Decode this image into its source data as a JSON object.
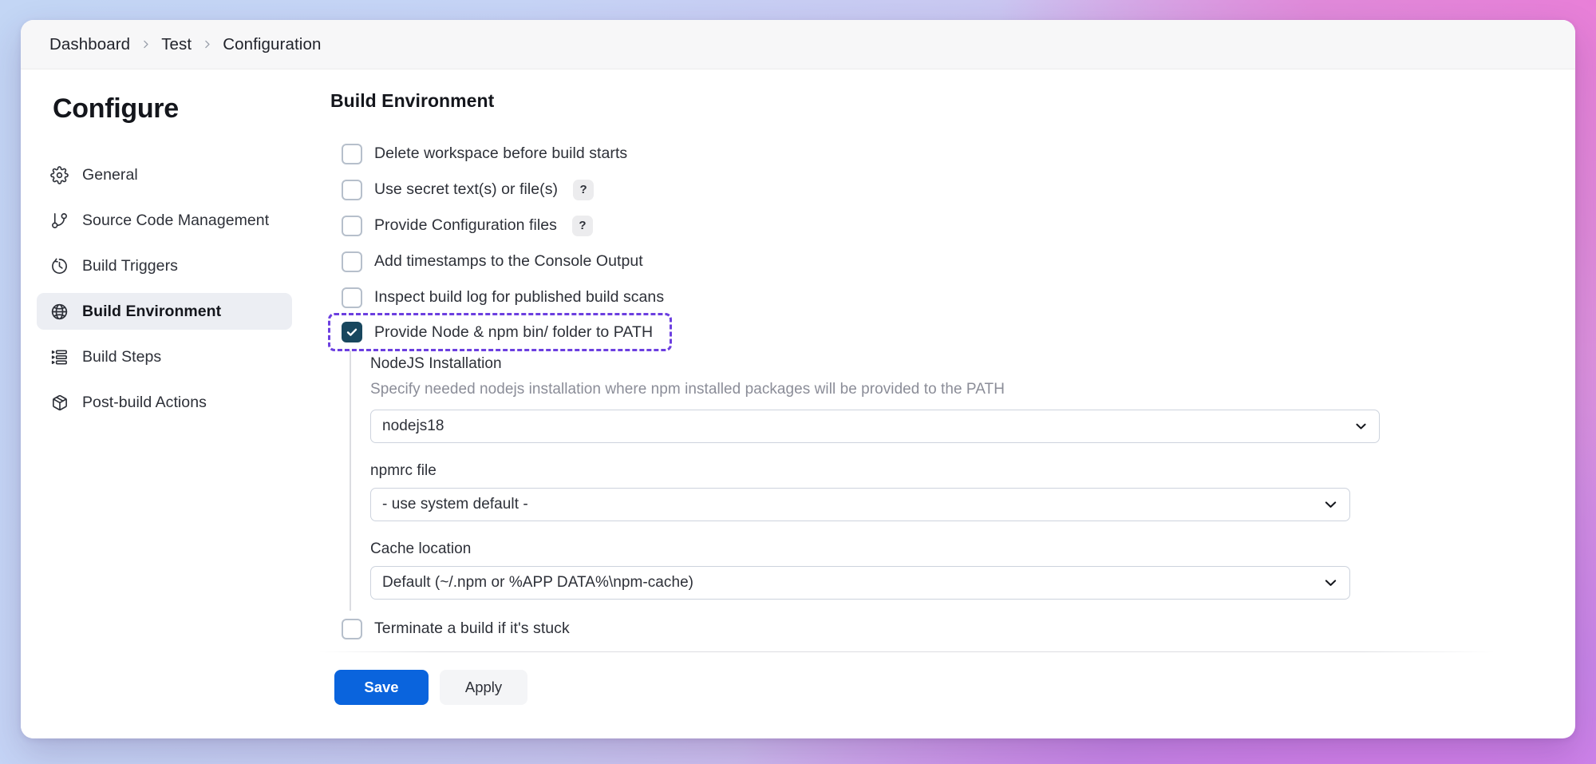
{
  "breadcrumb": {
    "items": [
      {
        "label": "Dashboard"
      },
      {
        "label": "Test"
      },
      {
        "label": "Configuration"
      }
    ]
  },
  "sidebar": {
    "title": "Configure",
    "items": [
      {
        "label": "General",
        "icon": "gear-icon",
        "active": false
      },
      {
        "label": "Source Code Management",
        "icon": "git-branch-icon",
        "active": false
      },
      {
        "label": "Build Triggers",
        "icon": "clock-icon",
        "active": false
      },
      {
        "label": "Build Environment",
        "icon": "globe-icon",
        "active": true
      },
      {
        "label": "Build Steps",
        "icon": "list-icon",
        "active": false
      },
      {
        "label": "Post-build Actions",
        "icon": "package-icon",
        "active": false
      }
    ]
  },
  "main": {
    "title": "Build Environment",
    "checkboxes": [
      {
        "label": "Delete workspace before build starts",
        "checked": false,
        "help": false
      },
      {
        "label": "Use secret text(s) or file(s)",
        "checked": false,
        "help": true,
        "help_label": "?"
      },
      {
        "label": "Provide Configuration files",
        "checked": false,
        "help": true,
        "help_label": "?"
      },
      {
        "label": "Add timestamps to the Console Output",
        "checked": false,
        "help": false
      },
      {
        "label": "Inspect build log for published build scans",
        "checked": false,
        "help": false
      },
      {
        "label": "Provide Node & npm bin/ folder to PATH",
        "checked": true,
        "help": false,
        "highlighted": true
      }
    ],
    "nodejs_section": {
      "installation": {
        "label": "NodeJS Installation",
        "description": "Specify needed nodejs installation where npm installed packages will be provided to the PATH",
        "value": "nodejs18"
      },
      "npmrc": {
        "label": "npmrc file",
        "value": "- use system default -"
      },
      "cache": {
        "label": "Cache location",
        "value": "Default (~/.npm or %APP DATA%\\npm-cache)"
      }
    },
    "terminate_checkbox": {
      "label": "Terminate a build if it's stuck",
      "checked": false
    }
  },
  "actions": {
    "save_label": "Save",
    "apply_label": "Apply"
  },
  "colors": {
    "primary_button": "#0a64dd",
    "checked_checkbox": "#18475e",
    "highlight_outline": "#6c3fe0",
    "active_nav_bg": "#eceef3"
  }
}
